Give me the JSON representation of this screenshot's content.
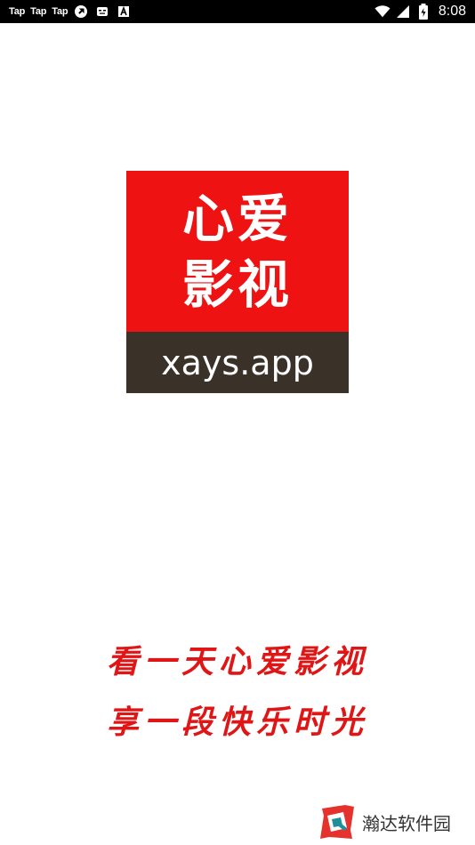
{
  "status_bar": {
    "notifications": [
      "Tap",
      "Tap",
      "Tap"
    ],
    "icons": [
      "sync-icon",
      "gamepad-icon",
      "font-icon",
      "wifi-icon",
      "signal-icon",
      "battery-icon"
    ],
    "time": "8:08"
  },
  "logo": {
    "line1": "心爱",
    "line2": "影视",
    "domain": "xays.app",
    "colors": {
      "top": "#ee1212",
      "bottom": "#3a3129"
    }
  },
  "slogan": {
    "line1": "看一天心爱影视",
    "line2": "享一段快乐时光",
    "color": "#e01616"
  },
  "watermark": {
    "text": "瀚达软件园"
  }
}
